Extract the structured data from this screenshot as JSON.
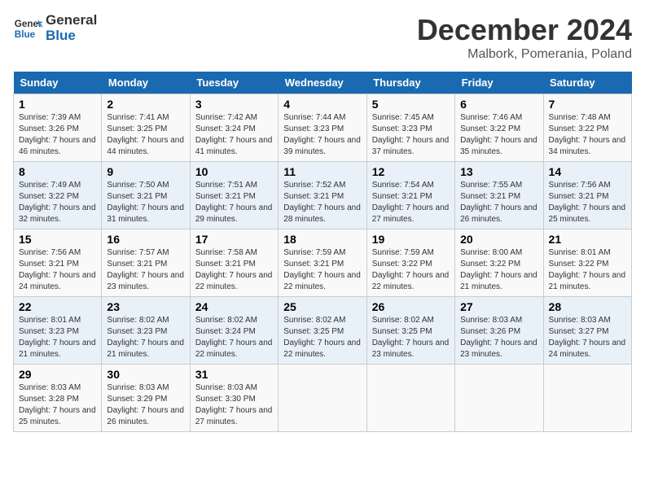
{
  "header": {
    "logo_line1": "General",
    "logo_line2": "Blue",
    "title": "December 2024",
    "subtitle": "Malbork, Pomerania, Poland"
  },
  "weekdays": [
    "Sunday",
    "Monday",
    "Tuesday",
    "Wednesday",
    "Thursday",
    "Friday",
    "Saturday"
  ],
  "weeks": [
    [
      {
        "day": "1",
        "sunrise": "7:39 AM",
        "sunset": "3:26 PM",
        "daylight": "7 hours and 46 minutes."
      },
      {
        "day": "2",
        "sunrise": "7:41 AM",
        "sunset": "3:25 PM",
        "daylight": "7 hours and 44 minutes."
      },
      {
        "day": "3",
        "sunrise": "7:42 AM",
        "sunset": "3:24 PM",
        "daylight": "7 hours and 41 minutes."
      },
      {
        "day": "4",
        "sunrise": "7:44 AM",
        "sunset": "3:23 PM",
        "daylight": "7 hours and 39 minutes."
      },
      {
        "day": "5",
        "sunrise": "7:45 AM",
        "sunset": "3:23 PM",
        "daylight": "7 hours and 37 minutes."
      },
      {
        "day": "6",
        "sunrise": "7:46 AM",
        "sunset": "3:22 PM",
        "daylight": "7 hours and 35 minutes."
      },
      {
        "day": "7",
        "sunrise": "7:48 AM",
        "sunset": "3:22 PM",
        "daylight": "7 hours and 34 minutes."
      }
    ],
    [
      {
        "day": "8",
        "sunrise": "7:49 AM",
        "sunset": "3:22 PM",
        "daylight": "7 hours and 32 minutes."
      },
      {
        "day": "9",
        "sunrise": "7:50 AM",
        "sunset": "3:21 PM",
        "daylight": "7 hours and 31 minutes."
      },
      {
        "day": "10",
        "sunrise": "7:51 AM",
        "sunset": "3:21 PM",
        "daylight": "7 hours and 29 minutes."
      },
      {
        "day": "11",
        "sunrise": "7:52 AM",
        "sunset": "3:21 PM",
        "daylight": "7 hours and 28 minutes."
      },
      {
        "day": "12",
        "sunrise": "7:54 AM",
        "sunset": "3:21 PM",
        "daylight": "7 hours and 27 minutes."
      },
      {
        "day": "13",
        "sunrise": "7:55 AM",
        "sunset": "3:21 PM",
        "daylight": "7 hours and 26 minutes."
      },
      {
        "day": "14",
        "sunrise": "7:56 AM",
        "sunset": "3:21 PM",
        "daylight": "7 hours and 25 minutes."
      }
    ],
    [
      {
        "day": "15",
        "sunrise": "7:56 AM",
        "sunset": "3:21 PM",
        "daylight": "7 hours and 24 minutes."
      },
      {
        "day": "16",
        "sunrise": "7:57 AM",
        "sunset": "3:21 PM",
        "daylight": "7 hours and 23 minutes."
      },
      {
        "day": "17",
        "sunrise": "7:58 AM",
        "sunset": "3:21 PM",
        "daylight": "7 hours and 22 minutes."
      },
      {
        "day": "18",
        "sunrise": "7:59 AM",
        "sunset": "3:21 PM",
        "daylight": "7 hours and 22 minutes."
      },
      {
        "day": "19",
        "sunrise": "7:59 AM",
        "sunset": "3:22 PM",
        "daylight": "7 hours and 22 minutes."
      },
      {
        "day": "20",
        "sunrise": "8:00 AM",
        "sunset": "3:22 PM",
        "daylight": "7 hours and 21 minutes."
      },
      {
        "day": "21",
        "sunrise": "8:01 AM",
        "sunset": "3:22 PM",
        "daylight": "7 hours and 21 minutes."
      }
    ],
    [
      {
        "day": "22",
        "sunrise": "8:01 AM",
        "sunset": "3:23 PM",
        "daylight": "7 hours and 21 minutes."
      },
      {
        "day": "23",
        "sunrise": "8:02 AM",
        "sunset": "3:23 PM",
        "daylight": "7 hours and 21 minutes."
      },
      {
        "day": "24",
        "sunrise": "8:02 AM",
        "sunset": "3:24 PM",
        "daylight": "7 hours and 22 minutes."
      },
      {
        "day": "25",
        "sunrise": "8:02 AM",
        "sunset": "3:25 PM",
        "daylight": "7 hours and 22 minutes."
      },
      {
        "day": "26",
        "sunrise": "8:02 AM",
        "sunset": "3:25 PM",
        "daylight": "7 hours and 23 minutes."
      },
      {
        "day": "27",
        "sunrise": "8:03 AM",
        "sunset": "3:26 PM",
        "daylight": "7 hours and 23 minutes."
      },
      {
        "day": "28",
        "sunrise": "8:03 AM",
        "sunset": "3:27 PM",
        "daylight": "7 hours and 24 minutes."
      }
    ],
    [
      {
        "day": "29",
        "sunrise": "8:03 AM",
        "sunset": "3:28 PM",
        "daylight": "7 hours and 25 minutes."
      },
      {
        "day": "30",
        "sunrise": "8:03 AM",
        "sunset": "3:29 PM",
        "daylight": "7 hours and 26 minutes."
      },
      {
        "day": "31",
        "sunrise": "8:03 AM",
        "sunset": "3:30 PM",
        "daylight": "7 hours and 27 minutes."
      },
      null,
      null,
      null,
      null
    ]
  ]
}
